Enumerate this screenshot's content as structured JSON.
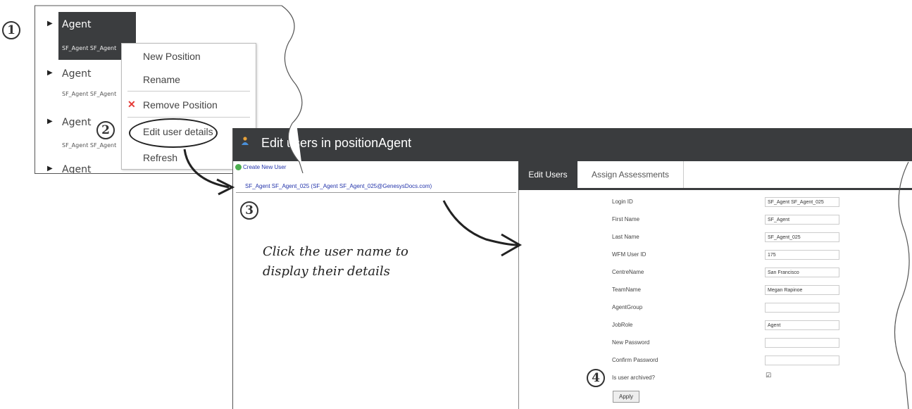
{
  "steps": {
    "s1": "1",
    "s2": "2",
    "s3": "3",
    "s4": "4"
  },
  "tree": {
    "items": [
      {
        "name": "Agent",
        "sub": "SF_Agent SF_Agent"
      },
      {
        "name": "Agent",
        "sub": "SF_Agent SF_Agent"
      },
      {
        "name": "Agent",
        "sub": "SF_Agent SF_Agent"
      },
      {
        "name": "Agent"
      }
    ]
  },
  "context_menu": {
    "new_position": "New Position",
    "rename": "Rename",
    "remove_position": "Remove Position",
    "edit_user_details": "Edit user details",
    "refresh": "Refresh"
  },
  "dialog": {
    "title": "Edit users in positionAgent",
    "create_new_user": "Create New User",
    "user_link": "SF_Agent SF_Agent_025 (SF_Agent SF_Agent_025@GenesysDocs.com)",
    "hint": "Click the user name to\ndisplay their details",
    "tabs": {
      "edit_users": "Edit Users",
      "assign_assessments": "Assign Assessments"
    },
    "fields": {
      "login_id": {
        "label": "Login ID",
        "value": "SF_Agent SF_Agent_025"
      },
      "first_name": {
        "label": "First Name",
        "value": "SF_Agent"
      },
      "last_name": {
        "label": "Last Name",
        "value": "SF_Agent_025"
      },
      "wfm_user_id": {
        "label": "WFM User ID",
        "value": "175"
      },
      "centre_name": {
        "label": "CentreName",
        "value": "San Francisco"
      },
      "team_name": {
        "label": "TeamName",
        "value": "Megan Rapinoe"
      },
      "agent_group": {
        "label": "AgentGroup",
        "value": ""
      },
      "job_role": {
        "label": "JobRole",
        "value": "Agent"
      },
      "new_password": {
        "label": "New Password",
        "value": ""
      },
      "confirm_password": {
        "label": "Confirm Password",
        "value": ""
      },
      "is_archived": {
        "label": "Is user archived?"
      }
    },
    "apply": "Apply"
  },
  "colors": {
    "title_bar": "#3a3c3e",
    "link": "#2233aa",
    "remove_x": "#e53935"
  }
}
